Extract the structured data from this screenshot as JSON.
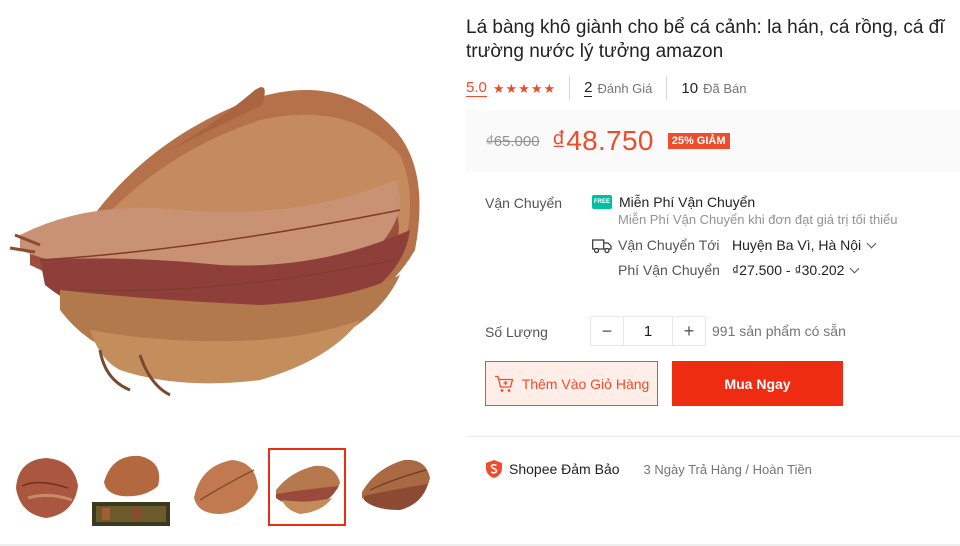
{
  "product": {
    "title_line1": "Lá bàng khô giành cho bể cá cảnh: la hán, cá rồng, cá đĩ",
    "title_line2": "trường nước lý tưởng amazon"
  },
  "stats": {
    "rating": "5.0",
    "stars": 5,
    "reviews_count": "2",
    "reviews_label": "Đánh Giá",
    "sold_count": "10",
    "sold_label": "Đã Bán"
  },
  "price": {
    "original": "₫65.000",
    "current": "₫48.750",
    "discount": "25% GIẢM"
  },
  "shipping": {
    "label": "Vận Chuyển",
    "free_icon_text": "FREE",
    "free_title": "Miễn Phí Vận Chuyển",
    "free_subtitle": "Miễn Phí Vận Chuyển khi đơn đạt giá trị tối thiểu",
    "to_label": "Vận Chuyển Tới",
    "to_value": "Huyện Ba Vì, Hà Nội",
    "fee_label": "Phí Vận Chuyển",
    "fee_value": "₫27.500 - ₫30.202"
  },
  "quantity": {
    "label": "Số Lượng",
    "minus": "−",
    "value": "1",
    "plus": "+",
    "stock": "991 sản phẩm có sẵn"
  },
  "actions": {
    "add_to_cart": "Thêm Vào Giỏ Hàng",
    "buy_now": "Mua Ngay"
  },
  "guarantee": {
    "title": "Shopee Đảm Bảo",
    "description": "3 Ngày Trả Hàng / Hoàn Tiền"
  },
  "colors": {
    "accent": "#ee4d2d",
    "buy_button": "#ee2c11",
    "freeship": "#00bfa5"
  }
}
